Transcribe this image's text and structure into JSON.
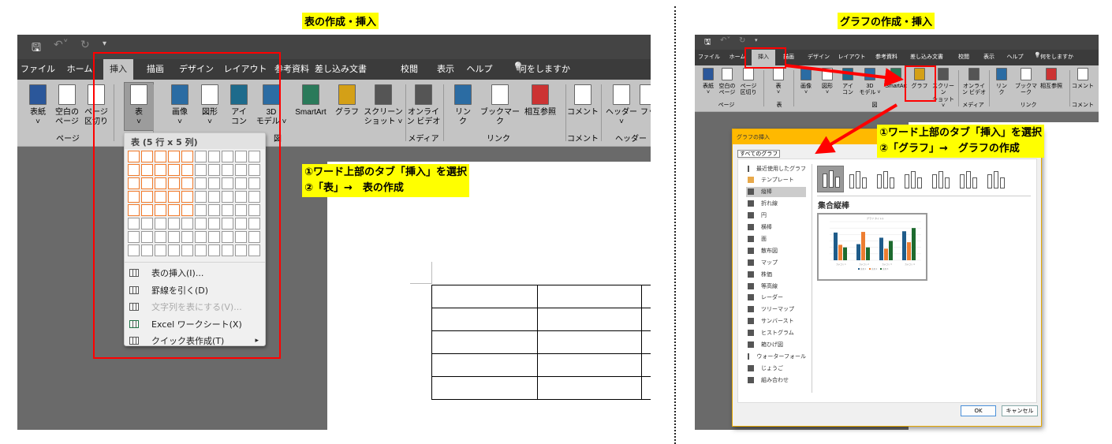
{
  "left_panel": {
    "title": "表の作成・挿入",
    "annotation": [
      "①ワード上部のタブ「挿入」を選択",
      "②「表」→　表の作成"
    ],
    "tabs": [
      "ファイル",
      "ホーム",
      "挿入",
      "描画",
      "デザイン",
      "レイアウト",
      "参考資料",
      "差し込み文書",
      "校閲",
      "表示",
      "ヘルプ",
      "何をしますか"
    ],
    "active_tab": "挿入",
    "ribbon_buttons": [
      "表紙\n˅",
      "空白の\nページ",
      "ページ\n区切り",
      "表\n˅",
      "画像\n˅",
      "図形\n˅",
      "アイ\nコン",
      "3D\nモデル ˅",
      "SmartArt",
      "グラフ",
      "スクリーン\nショット ˅",
      "オンライ\nン ビデオ",
      "リン\nク",
      "ブックマーク",
      "相互参照",
      "コメント",
      "ヘッダー\n˅",
      "フッ"
    ],
    "group_labels": [
      "ページ",
      "図",
      "メディア",
      "リンク",
      "コメント",
      "ヘッダー"
    ],
    "table_menu": {
      "header": "表 (5 行 x 5 列)",
      "grid": {
        "rows": 8,
        "cols": 10,
        "selected_rows": 5,
        "selected_cols": 5
      },
      "items": [
        {
          "label": "表の挿入(I)...",
          "enabled": true
        },
        {
          "label": "罫線を引く(D)",
          "enabled": true
        },
        {
          "label": "文字列を表にする(V)...",
          "enabled": false
        },
        {
          "label": "Excel ワークシート(X)",
          "enabled": true
        },
        {
          "label": "クイック表作成(T)",
          "enabled": true,
          "submenu": "▸"
        }
      ]
    },
    "document_table": {
      "rows": 5,
      "cols": 3
    }
  },
  "right_panel": {
    "title": "グラフの作成・挿入",
    "annotation": [
      "①ワード上部のタブ「挿入」を選択",
      "②「グラフ」→　グラフの作成"
    ],
    "tabs": [
      "ファイル",
      "ホーム",
      "挿入",
      "描画",
      "デザイン",
      "レイアウト",
      "参考資料",
      "差し込み文書",
      "校閲",
      "表示",
      "ヘルプ",
      "何をしますか"
    ],
    "ribbon_buttons": [
      "表紙\n˅",
      "空白の\nページ",
      "ページ\n区切り",
      "表\n˅",
      "画像\n˅",
      "図形\n˅",
      "アイ\nコン",
      "3D\nモデル ˅",
      "SmartArt",
      "グラフ",
      "スクリーン\nショット ˅",
      "オンライ\nン ビデオ",
      "リン\nク",
      "ブックマーク",
      "相互参照",
      "コメント"
    ],
    "group_labels": [
      "ページ",
      "表",
      "図",
      "メディア",
      "リンク",
      "コメント"
    ],
    "dialog": {
      "title": "グラフの挿入",
      "tab": "すべてのグラフ",
      "categories": [
        "最近使用したグラフ",
        "テンプレート",
        "縦棒",
        "折れ線",
        "円",
        "横棒",
        "面",
        "散布図",
        "マップ",
        "株価",
        "等高線",
        "レーダー",
        "ツリーマップ",
        "サンバースト",
        "ヒストグラム",
        "箱ひげ図",
        "ウォーターフォール",
        "じょうご",
        "組み合わせ"
      ],
      "selected_category": "縦棒",
      "subtype_title": "集合縦棒",
      "preview": {
        "title": "グラフ タイトル",
        "categories": [
          "カテゴリ 1",
          "カテゴリ 2",
          "カテゴリ 3",
          "カテゴリ 4"
        ],
        "series": [
          {
            "name": "系列 1",
            "color": "#1f5c8a",
            "values": [
              4.3,
              2.5,
              3.5,
              4.5
            ]
          },
          {
            "name": "系列 2",
            "color": "#ed7d31",
            "values": [
              2.4,
              4.4,
              1.8,
              2.8
            ]
          },
          {
            "name": "系列 3",
            "color": "#1e6b2f",
            "values": [
              2.0,
              2.0,
              3.0,
              5.0
            ]
          }
        ],
        "ymax": 6
      },
      "ok": "OK",
      "cancel": "キャンセル"
    }
  },
  "colors": {
    "highlight": "#ffff00",
    "annotation_red": "#ff0000",
    "grid_selected": "#f27a2a",
    "dialog_title": "#ffb900"
  }
}
